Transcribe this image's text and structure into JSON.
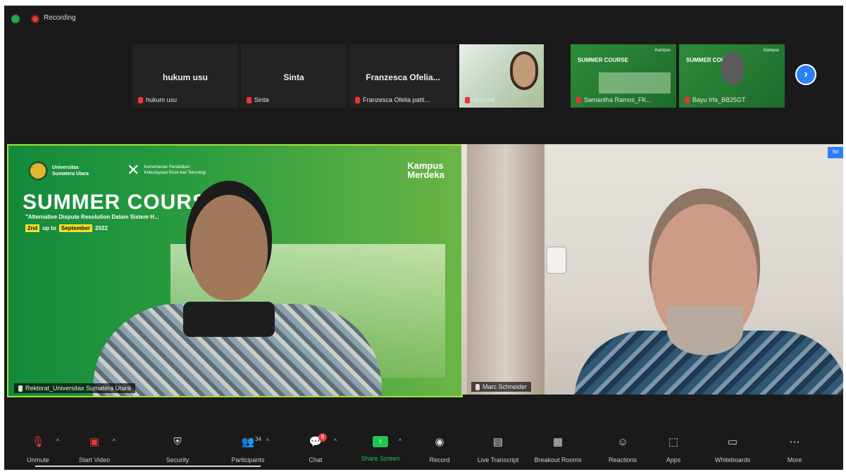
{
  "status": {
    "recording_label": "Recording"
  },
  "thumbnails": [
    {
      "center_name": "hukum usu",
      "caption": "hukum usu"
    },
    {
      "center_name": "Sinta",
      "caption": "Sinta"
    },
    {
      "center_name": "Franzesca Ofelia...",
      "caption": "Franzesca Ofelia patti..."
    },
    {
      "center_name": "",
      "caption": "Mazhafi"
    },
    {
      "center_name": "",
      "caption": "Samantha Ramos_FK..."
    },
    {
      "center_name": "",
      "caption": "Bayu Irfa_BB25GT"
    }
  ],
  "thumb_green": {
    "title": "SUMMER COURSE",
    "logo": "Kampus"
  },
  "main": {
    "left": {
      "uni_name": "Universitas Sumatera Utara",
      "ministry_text": "Kementerian Pendidikan Kebudayaan Riset dan Teknologi",
      "banner_title": "SUMMER COURSE",
      "banner_subtitle": "\"Alternative Dispute Resolution Dalam Sistem H...",
      "date_start": "2nd",
      "date_mid": "up to",
      "date_end": "September",
      "date_year": "2022",
      "kampus_line1": "Kampus",
      "kampus_line2": "Merdeka",
      "name_tag": "Rektorat_Universitas Sumatera Utara"
    },
    "right": {
      "badge": "ftd",
      "name_tag": "Marc Schneider"
    }
  },
  "toolbar": [
    {
      "key": "unmute",
      "label": "Unmute",
      "icon": "mic-off-icon",
      "glyph": "🎙",
      "caret": "^"
    },
    {
      "key": "start_video",
      "label": "Start Video",
      "icon": "video-off-icon",
      "glyph": "▣",
      "caret": "^"
    },
    {
      "key": "security",
      "label": "Security",
      "icon": "shield-icon",
      "glyph": "⛨",
      "caret": ""
    },
    {
      "key": "participants",
      "label": "Participants",
      "icon": "people-icon",
      "glyph": "👥",
      "caret": "^",
      "count": "34"
    },
    {
      "key": "chat",
      "label": "Chat",
      "icon": "chat-icon",
      "glyph": "💬",
      "caret": "^",
      "badge": "8"
    },
    {
      "key": "share_screen",
      "label": "Share Screen",
      "icon": "share-screen-icon",
      "glyph": "↑",
      "caret": "^"
    },
    {
      "key": "record",
      "label": "Record",
      "icon": "record-icon",
      "glyph": "◉",
      "caret": ""
    },
    {
      "key": "live_transcript",
      "label": "Live Transcript",
      "icon": "cc-icon",
      "glyph": "▤",
      "caret": ""
    },
    {
      "key": "breakout_rooms",
      "label": "Breakout Rooms",
      "icon": "grid-icon",
      "glyph": "▦",
      "caret": ""
    },
    {
      "key": "reactions",
      "label": "Reactions",
      "icon": "emoji-icon",
      "glyph": "☺",
      "caret": ""
    },
    {
      "key": "apps",
      "label": "Apps",
      "icon": "apps-icon",
      "glyph": "⬚",
      "caret": ""
    },
    {
      "key": "whiteboards",
      "label": "Whiteboards",
      "icon": "whiteboard-icon",
      "glyph": "▭",
      "caret": ""
    },
    {
      "key": "more",
      "label": "More",
      "icon": "more-icon",
      "glyph": "⋯",
      "caret": ""
    }
  ],
  "colors": {
    "accent_green": "#23c552",
    "active_speaker_border": "#a4e03a",
    "nav_blue": "#2d7ff9"
  }
}
